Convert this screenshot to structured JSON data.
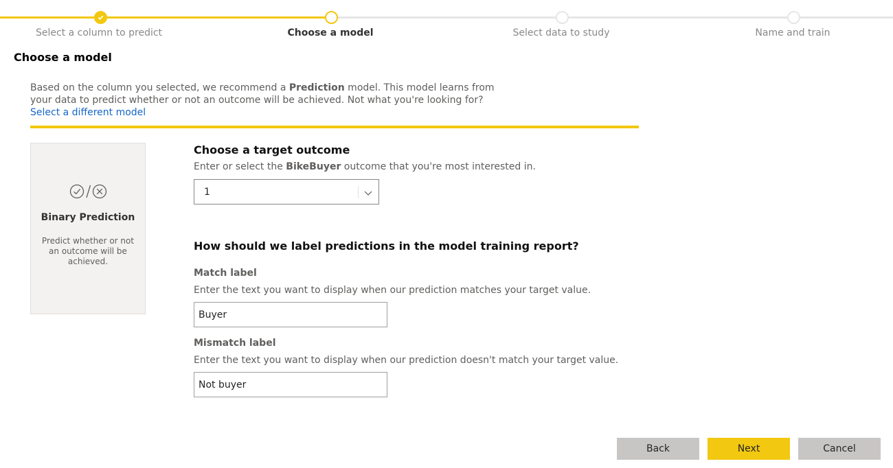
{
  "stepper": {
    "steps": [
      {
        "label": "Select a column to predict",
        "state": "done"
      },
      {
        "label": "Choose a model",
        "state": "active"
      },
      {
        "label": "Select data to study",
        "state": "pending"
      },
      {
        "label": "Name and train",
        "state": "pending"
      }
    ],
    "accent_color": "#f2c811"
  },
  "page_title": "Choose a model",
  "intro": {
    "text_before": "Based on the column you selected, we recommend a ",
    "model_name": "Prediction",
    "text_after": " model. This model learns from your data to predict whether or not an outcome will be achieved. Not what you're looking for?",
    "link": "Select a different model"
  },
  "model_card": {
    "icon": "check-slash-x-icon",
    "title": "Binary Prediction",
    "description": "Predict whether or not an outcome will be achieved."
  },
  "target": {
    "heading": "Choose a target outcome",
    "sub_before": "Enter or select the ",
    "column": "BikeBuyer",
    "sub_after": " outcome that you're most interested in.",
    "selected_value": "1"
  },
  "labels": {
    "heading": "How should we label predictions in the model training report?",
    "match_label": "Match label",
    "match_hint": "Enter the text you want to display when our prediction matches your target value.",
    "match_value": "Buyer",
    "mismatch_label": "Mismatch label",
    "mismatch_hint": "Enter the text you want to display when our prediction doesn't match your target value.",
    "mismatch_value": "Not buyer"
  },
  "buttons": {
    "back": "Back",
    "next": "Next",
    "cancel": "Cancel"
  }
}
